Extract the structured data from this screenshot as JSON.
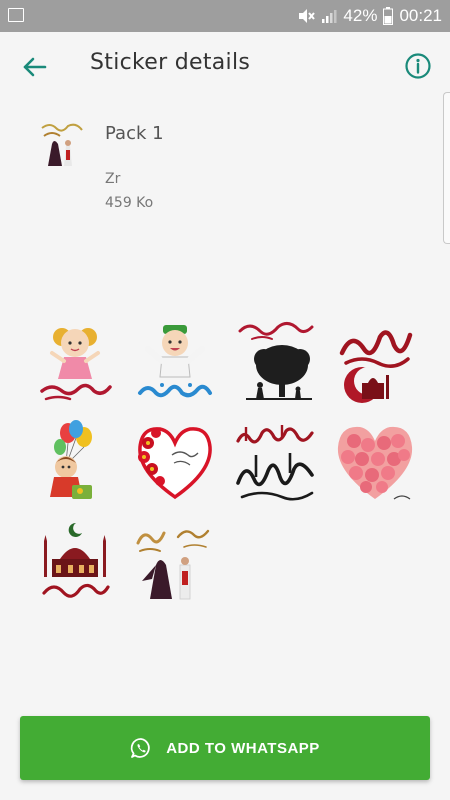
{
  "status_bar": {
    "battery": "42%",
    "time": "00:21",
    "icons": [
      "image-icon",
      "mute-icon",
      "signal-icon",
      "battery-icon"
    ]
  },
  "header": {
    "title": "Sticker details",
    "back_icon": "arrow-left-icon",
    "info_icon": "info-icon"
  },
  "pack": {
    "name": "Pack 1",
    "author": "Zr",
    "size": "459 Ko"
  },
  "stickers": [
    "girl-eid-mubarak",
    "boy-eid-saeed",
    "tree-eid-mubarak",
    "red-calligraphy-mosque",
    "boy-with-balloons",
    "heart-flower-frame",
    "eid-fitr-calligraphy",
    "rose-heart",
    "mosque-crescent",
    "eid-mubarak-figures"
  ],
  "footer": {
    "button_label": "ADD TO WHATSAPP",
    "button_icon": "whatsapp-icon"
  },
  "colors": {
    "accent": "#1a8a7a",
    "button": "#43ac34",
    "status_bar": "#9e9e9e"
  }
}
